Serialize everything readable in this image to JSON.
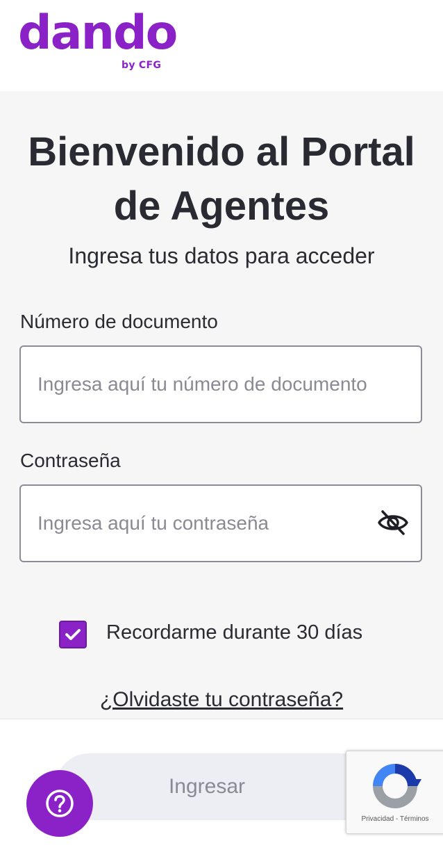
{
  "brand": {
    "logo_text": "dando",
    "logo_subtext": "by CFG",
    "color": "#8a22c8"
  },
  "main": {
    "title": "Bienvenido al Portal de Agentes",
    "subtitle": "Ingresa tus datos para acceder"
  },
  "form": {
    "document": {
      "label": "Número de documento",
      "value": "",
      "placeholder": "Ingresa aquí tu número de documento"
    },
    "password": {
      "label": "Contraseña",
      "value": "",
      "placeholder": "Ingresa aquí tu contraseña",
      "visibility_icon": "eye-off-icon"
    },
    "remember": {
      "label": "Recordarme durante 30 días",
      "checked": true
    },
    "forgot_link": "¿Olvidaste tu contraseña?",
    "submit_label": "Ingresar"
  },
  "help": {
    "icon": "question-circle-icon"
  },
  "recaptcha": {
    "privacy": "Privacidad",
    "separator": " - ",
    "terms": "Términos"
  },
  "colors": {
    "accent": "#8a22c8",
    "text": "#2a2a33",
    "placeholder": "#8a8a94",
    "button_disabled_bg": "#eceef3"
  }
}
